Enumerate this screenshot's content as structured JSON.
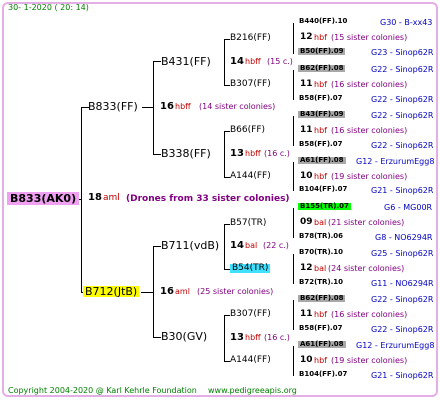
{
  "header": {
    "date": "30-   1-2020  (  20:  14)"
  },
  "root": {
    "name": "B833(AK0)",
    "gen": "18",
    "code": "aml",
    "note": "(Drones from 33 sister colonies)"
  },
  "father": {
    "name": "B833(FF)",
    "gen": "16",
    "code": "hbff",
    "note": "(14 sister colonies)"
  },
  "mother": {
    "name": "B712(JtB)",
    "gen": "16",
    "code": "aml",
    "note": "(25 sister colonies)"
  },
  "gf1": {
    "name": "B431(FF)",
    "gen": "14",
    "code": "hbff",
    "note": "(15 c.)"
  },
  "gf2": {
    "name": "B338(FF)",
    "gen": "13",
    "code": "hbff",
    "note": "(16 c.)"
  },
  "gm1": {
    "name": "B711(vdB)",
    "gen": "14",
    "code": "bal",
    "note": "(22 c.)"
  },
  "gm2": {
    "name": "B30(GV)",
    "gen": "13",
    "code": "hbff",
    "note": "(16 c.)"
  },
  "g3": [
    {
      "name": "B216(FF)"
    },
    {
      "name": "B307(FF)"
    },
    {
      "name": "B66(FF)"
    },
    {
      "name": "A144(FF)"
    },
    {
      "name": "B57(TR)"
    },
    {
      "name": "B54(TR)"
    },
    {
      "name": "B307(FF)"
    },
    {
      "name": "A144(FF)"
    }
  ],
  "g4": [
    {
      "a": "B440(FF).10",
      "b": "G30 - B-xx43",
      "gen": "12",
      "code": "hbf",
      "note": "(15 sister colonies)",
      "c": "B50(FF).09",
      "d": "G23 - Sinop62R"
    },
    {
      "a": "B62(FF).08",
      "b": "G22 - Sinop62R",
      "gen": "11",
      "code": "hbf",
      "note": "(16 sister colonies)",
      "c": "B58(FF).07",
      "d": "G22 - Sinop62R"
    },
    {
      "a": "B43(FF).09",
      "b": "G22 - Sinop62R",
      "gen": "11",
      "code": "hbf",
      "note": "(16 sister colonies)",
      "c": "B58(FF).07",
      "d": "G22 - Sinop62R"
    },
    {
      "a": "A61(FF).08",
      "b": "G12 - ErzurumEgg8",
      "gen": "10",
      "code": "hbf",
      "note": "(19 sister colonies)",
      "c": "B104(FF).07",
      "d": "G21 - Sinop62R"
    },
    {
      "a": "B155(TR).07",
      "b": "G6 - MG00R",
      "gen": "09",
      "code": "bal",
      "note": "(21 sister colonies)",
      "c": "B78(TR).06",
      "d": "G8 - NO6294R"
    },
    {
      "a": "B70(TR).10",
      "b": "G25 - Sinop62R",
      "gen": "12",
      "code": "bal",
      "note": "(24 sister colonies)",
      "c": "B72(TR).10",
      "d": "G11 - NO6294R"
    },
    {
      "a": "B62(FF).08",
      "b": "G22 - Sinop62R",
      "gen": "11",
      "code": "hbf",
      "note": "(16 sister colonies)",
      "c": "B58(FF).07",
      "d": "G22 - Sinop62R"
    },
    {
      "a": "A61(FF).08",
      "b": "G12 - ErzurumEgg8",
      "gen": "10",
      "code": "hbf",
      "note": "(19 sister colonies)",
      "c": "B104(FF).07",
      "d": "G21 - Sinop62R"
    }
  ],
  "footer": {
    "copyright": "Copyright 2004-2020 @ Karl Kehrle Foundation",
    "site": "www.pedigreeapis.org"
  }
}
